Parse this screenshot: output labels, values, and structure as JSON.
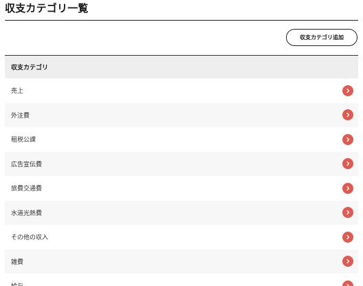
{
  "page": {
    "title": "収支カテゴリ一覧"
  },
  "toolbar": {
    "add_label": "収支カテゴリ追加"
  },
  "table": {
    "header": "収支カテゴリ",
    "rows": [
      "売上",
      "外注費",
      "租税公課",
      "広告宣伝費",
      "旅費交通費",
      "水道光熱費",
      "その他の収入",
      "雑費",
      "給与"
    ]
  },
  "colors": {
    "accent": "#e05a52",
    "header_bg": "#eeeeee",
    "stripe_bg": "#f7f7f7"
  },
  "icons": {
    "row_action": "chevron-right-icon"
  }
}
